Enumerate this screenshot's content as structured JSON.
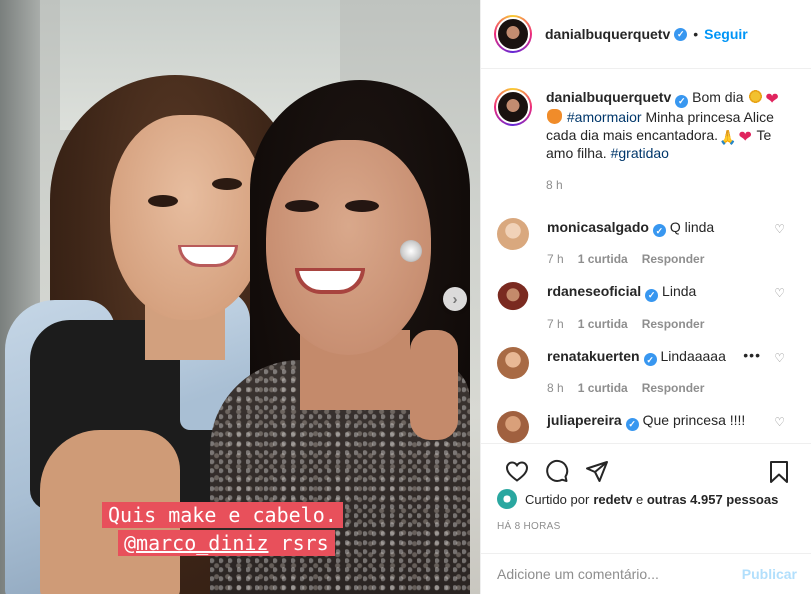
{
  "post": {
    "username": "danialbuquerquetv",
    "follow_label": "Seguir",
    "separator": "•",
    "image": {
      "caption_line1": "Quis make e cabelo.",
      "caption_line2_prefix": "@",
      "caption_line2_handle": "marco_diniz",
      "caption_line2_suffix": " rsrs"
    },
    "caption": {
      "username": "danialbuquerquetv",
      "text1": " Bom dia ",
      "hashtag1": "#amormaior",
      "text2": " Minha princesa Alice cada dia mais encantadora.",
      "text3": " Te amo filha. ",
      "hashtag2": "#gratidao",
      "time": "8 h"
    },
    "comments": [
      {
        "username": "monicasalgado",
        "text": "Q linda",
        "time": "7 h",
        "likes": "1 curtida",
        "reply": "Responder",
        "avatar_color": "#d9a87e"
      },
      {
        "username": "rdaneseoficial",
        "text": "Linda",
        "time": "7 h",
        "likes": "1 curtida",
        "reply": "Responder",
        "avatar_color": "#7a2a20"
      },
      {
        "username": "renatakuerten",
        "text": "Lindaaaaa",
        "time": "8 h",
        "likes": "1 curtida",
        "reply": "Responder",
        "avatar_color": "#c98f6a"
      },
      {
        "username": "juliapereira",
        "text": "Que princesa !!!!",
        "avatar_color": "#a0603f"
      }
    ],
    "likes": {
      "prefix": "Curtido por ",
      "user": "redetv",
      "middle": " e ",
      "others": "outras 4.957 pessoas"
    },
    "ago": "HÁ 8 HORAS",
    "comment_input": {
      "placeholder": "Adicione um comentário...",
      "publish_label": "Publicar"
    }
  },
  "colors": {
    "accent": "#0095f6",
    "verified": "#3897f0",
    "caption_sticker": "#e8505b",
    "muted": "#8e8e8e"
  },
  "icons": [
    "verified-icon",
    "heart-icon",
    "comment-icon",
    "share-icon",
    "bookmark-icon",
    "more-icon",
    "chevron-right-icon"
  ]
}
